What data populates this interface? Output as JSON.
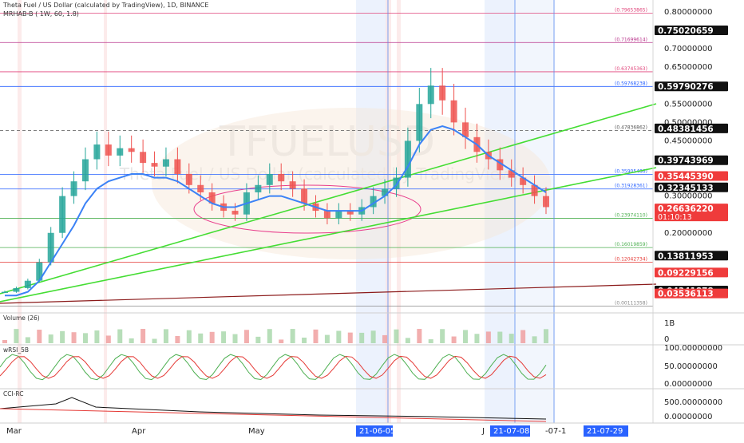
{
  "header": {
    "title": "Theta Fuel / US Dollar (calculated by TradingView), 1D, BINANCE",
    "indicator": "MRHAB-B ( 1W, 60, 1.8)"
  },
  "watermark": {
    "symbol": "TFUELUSD",
    "subtitle": "Theta Fuel / US Dollar (calculated by TradingView)"
  },
  "chart_data": {
    "type": "line",
    "title": "Theta Fuel / US Dollar (calculated by TradingView), 1D, BINANCE",
    "price_axis": {
      "ticks": [
        "0.80000000",
        "0.70000000",
        "0.65000000",
        "0.55000000",
        "0.50000000",
        "0.45000000",
        "0.30000000",
        "0.25000000",
        "0.20000000"
      ],
      "ylim": [
        0.0,
        0.82
      ],
      "badges": [
        {
          "text": "0.75020659",
          "style": "dark"
        },
        {
          "text": "0.59790276",
          "style": "dark"
        },
        {
          "text": "0.48381456",
          "style": "dark"
        },
        {
          "text": "0.39743969",
          "style": "dark"
        },
        {
          "text": "0.35445390",
          "style": "red"
        },
        {
          "text": "0.32345133",
          "style": "dark"
        },
        {
          "text": "0.26636220",
          "style": "red",
          "sub": "01:10:13"
        },
        {
          "text": "0.13811953",
          "style": "dark"
        },
        {
          "text": "0.09229156",
          "style": "red"
        },
        {
          "text": "0.04341878",
          "style": "dark"
        },
        {
          "text": "0.03536113",
          "style": "red"
        }
      ]
    },
    "levels": [
      {
        "label": "(0.79653865)",
        "value": 0.7965,
        "color": "#e0457b"
      },
      {
        "label": "(0.71699614)",
        "value": 0.717,
        "color": "#b8328a"
      },
      {
        "label": "(0.63745363)",
        "value": 0.6375,
        "color": "#e0457b"
      },
      {
        "label": "(0.59768238)",
        "value": 0.5977,
        "color": "#2962ff"
      },
      {
        "label": "(0.47836862)",
        "value": 0.4784,
        "color": "#555555"
      },
      {
        "label": "(0.35905486)",
        "value": 0.3591,
        "color": "#2962ff"
      },
      {
        "label": "(0.31928361)",
        "value": 0.3193,
        "color": "#2962ff"
      },
      {
        "label": "(0.23974110)",
        "value": 0.2397,
        "color": "#4caf50"
      },
      {
        "label": "(0.16019859)",
        "value": 0.1602,
        "color": "#4caf50"
      },
      {
        "label": "(0.12042734)",
        "value": 0.1204,
        "color": "#e53935"
      },
      {
        "label": "(0.00111358)",
        "value": 0.0011,
        "color": "#888888"
      }
    ],
    "x_axis": {
      "labels": [
        "Mar",
        "Apr",
        "May",
        "J",
        "-07-1"
      ],
      "highlighted": [
        "21-06-05",
        "21-07-08",
        "21-07-29"
      ]
    },
    "series": [
      {
        "name": "close",
        "values": [
          0.04,
          0.05,
          0.07,
          0.12,
          0.2,
          0.3,
          0.34,
          0.4,
          0.44,
          0.41,
          0.43,
          0.42,
          0.39,
          0.38,
          0.4,
          0.36,
          0.33,
          0.31,
          0.28,
          0.26,
          0.25,
          0.31,
          0.33,
          0.36,
          0.34,
          0.32,
          0.28,
          0.26,
          0.24,
          0.26,
          0.25,
          0.27,
          0.3,
          0.32,
          0.35,
          0.45,
          0.55,
          0.6,
          0.56,
          0.5,
          0.46,
          0.42,
          0.4,
          0.37,
          0.35,
          0.33,
          0.3,
          0.27
        ]
      },
      {
        "name": "ma_blue",
        "values": [
          0.03,
          0.03,
          0.04,
          0.07,
          0.12,
          0.17,
          0.22,
          0.28,
          0.32,
          0.34,
          0.35,
          0.36,
          0.36,
          0.35,
          0.35,
          0.34,
          0.32,
          0.3,
          0.28,
          0.27,
          0.27,
          0.28,
          0.29,
          0.3,
          0.3,
          0.29,
          0.28,
          0.27,
          0.26,
          0.26,
          0.26,
          0.26,
          0.28,
          0.3,
          0.33,
          0.38,
          0.44,
          0.48,
          0.49,
          0.48,
          0.46,
          0.44,
          0.41,
          0.39,
          0.37,
          0.35,
          0.33,
          0.31
        ]
      }
    ],
    "sub_panels": [
      {
        "name": "Volume (26)",
        "ticks": [
          "1B",
          "0"
        ]
      },
      {
        "name": "wRSI_5B",
        "ticks": [
          "100.00000000",
          "50.00000000",
          "0.00000000"
        ]
      },
      {
        "name": "CCI-RC",
        "ticks": [
          "500.00000000",
          "0.00000000"
        ]
      }
    ]
  }
}
